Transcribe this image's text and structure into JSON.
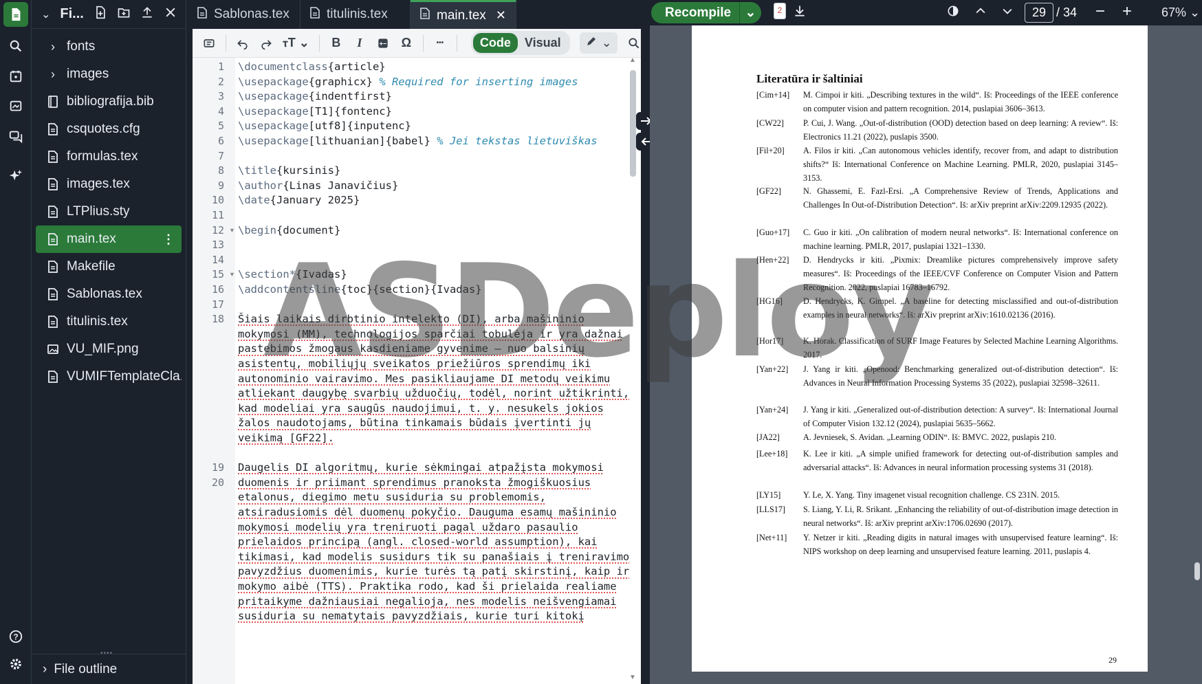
{
  "file_tree": {
    "title": "Fi...",
    "items": [
      {
        "name": "fonts",
        "type": "folder"
      },
      {
        "name": "images",
        "type": "folder"
      },
      {
        "name": "bibliografija.bib",
        "type": "bib"
      },
      {
        "name": "csquotes.cfg",
        "type": "file"
      },
      {
        "name": "formulas.tex",
        "type": "file"
      },
      {
        "name": "images.tex",
        "type": "file"
      },
      {
        "name": "LTPlius.sty",
        "type": "file"
      },
      {
        "name": "main.tex",
        "type": "file",
        "selected": true
      },
      {
        "name": "Makefile",
        "type": "file"
      },
      {
        "name": "Sablonas.tex",
        "type": "file"
      },
      {
        "name": "titulinis.tex",
        "type": "file"
      },
      {
        "name": "VU_MIF.png",
        "type": "image"
      },
      {
        "name": "VUMIFTemplateCla...",
        "type": "file"
      }
    ],
    "outline_label": "File outline"
  },
  "tabs": [
    {
      "label": "Sablonas.tex"
    },
    {
      "label": "titulinis.tex"
    },
    {
      "label": "main.tex",
      "active": true
    }
  ],
  "toolbar": {
    "text_size_label": "ⲧT",
    "bold_label": "B",
    "italic_label": "I",
    "omega_label": "Ω",
    "more_label": "•••",
    "code_label": "Code",
    "visual_label": "Visual"
  },
  "editor": {
    "line_numbers": [
      "1",
      "2",
      "3",
      "4",
      "5",
      "6",
      "7",
      "8",
      "9",
      "10",
      "11",
      "12",
      "13",
      "14",
      "15",
      "16",
      "17",
      "18",
      "",
      "",
      "",
      "",
      "",
      "",
      "",
      "",
      "",
      "19",
      "20"
    ],
    "lines": [
      "\\documentclass{article}",
      "\\usepackage{graphicx} % Required for inserting images",
      "\\usepackage{indentfirst}",
      "\\usepackage[T1]{fontenc}",
      "\\usepackage[utf8]{inputenc}",
      "\\usepackage[lithuanian]{babel} % Jei tekstas lietuviškas",
      "",
      "\\title{kursinis}",
      "\\author{Linas Janavičius}",
      "\\date{January 2025}",
      "",
      "\\begin{document}",
      "",
      "",
      "\\section*{Ivadas}",
      "\\addcontentsline{toc}{section}{Ivadas}",
      "",
      "Šiais laikais dirbtinio intelekto (DI), arba mašininio",
      "mokymosi (MM), technologijos sparčiai tobulėja ir yra dažnai",
      "pastebimos žmogaus kasdieniame gyvenime – nuo balsinių",
      "asistentų, mobiliųjų sveikatos priežiūros sprendimų iki",
      "autonominio vairavimo. Mes pasikliaujame DI metodų veikimu",
      "atliekant daugybę svarbių užduočių, todėl, norint užtikrinti,",
      "kad modeliai yra saugūs naudojimui, t. y. nesukels jokios",
      "žalos naudotojams, būtina tinkamais būdais įvertinti jų",
      "veikimą [GF22].",
      "",
      "Daugelis DI algoritmų, kurie sėkmingai atpažįsta mokymosi",
      "duomenis ir priimant sprendimus pranoksta žmogiškuosius",
      "etalonus, diegimo metu susiduria su problemomis,",
      "atsiradusiomis dėl duomenų pokyčio. Dauguma esamų mašininio",
      "mokymosi modelių yra treniruoti pagal uždaro pasaulio",
      "prielaidos principą (angl. closed-world assumption), kai",
      "tikimasi, kad modelis susidurs tik su panašiais į treniravimo",
      "pavyzdžius duomenimis, kurie turės tą patį skirstinį, kaip ir",
      "mokymo aibė (TTS). Praktika rodo, kad ši prielaida realiame",
      "pritaikyme dažniausiai negalioja, nes modelis neišvengiamai",
      "susiduria su nematytais pavyzdžiais, kurie turi kitokį"
    ]
  },
  "pdf": {
    "recompile_label": "Recompile",
    "log_badge": "2",
    "page_current": "29",
    "page_total": "/ 34",
    "zoom": "67%",
    "page_number": "29",
    "section_title": "Literatūra ir šaltiniai",
    "references": [
      {
        "key": "[Cim+14]",
        "text": "M. Cimpoi ir kiti. „Describing textures in the wild“. Iš: Proceedings of the IEEE conference on computer vision and pattern recognition. 2014, puslapiai 3606–3613."
      },
      {
        "key": "[CW22]",
        "text": "P. Cui, J. Wang. „Out-of-distribution (OOD) detection based on deep learning: A review“. Iš: Electronics 11.21 (2022), puslapis 3500."
      },
      {
        "key": "[Fil+20]",
        "text": "A. Filos ir kiti. „Can autonomous vehicles identify, recover from, and adapt to distribution shifts?“ Iš: International Conference on Machine Learning. PMLR, 2020, puslapiai 3145–3153."
      },
      {
        "key": "[GF22]",
        "text": "N. Ghassemi, E. Fazl-Ersi. „A Comprehensive Review of Trends, Applications and Challenges In Out-of-Distribution Detection“. Iš: arXiv preprint arXiv:2209.12935 (2022)."
      },
      {
        "key": "[Guo+17]",
        "text": "C. Guo ir kiti. „On calibration of modern neural networks“. Iš: International conference on machine learning. PMLR, 2017, puslapiai 1321–1330."
      },
      {
        "key": "[Hen+22]",
        "text": "D. Hendrycks ir kiti. „Pixmix: Dreamlike pictures comprehensively improve safety measures“. Iš: Proceedings of the IEEE/CVF Conference on Computer Vision and Pattern Recognition. 2022, puslapiai 16783–16792."
      },
      {
        "key": "[HG16]",
        "text": "D. Hendrycks, K. Gimpel. „A baseline for detecting misclassified and out-of-distribution examples in neural networks“. Iš: arXiv preprint arXiv:1610.02136 (2016)."
      },
      {
        "key": "[Hor17]",
        "text": "K. Horak. Classification of SURF Image Features by Selected Machine Learning Algorithms. 2017."
      },
      {
        "key": "[Yan+22]",
        "text": "J. Yang ir kiti. „Openood: Benchmarking generalized out-of-distribution detection“. Iš: Advances in Neural Information Processing Systems 35 (2022), puslapiai 32598–32611."
      },
      {
        "key": "[Yan+24]",
        "text": "J. Yang ir kiti. „Generalized out-of-distribution detection: A survey“. Iš: International Journal of Computer Vision 132.12 (2024), puslapiai 5635–5662."
      },
      {
        "key": "[JA22]",
        "text": "A. Jevniesek, S. Avidan. „Learning ODIN“. Iš: BMVC. 2022, puslapis 210."
      },
      {
        "key": "[Lee+18]",
        "text": "K. Lee ir kiti. „A simple unified framework for detecting out-of-distribution samples and adversarial attacks“. Iš: Advances in neural information processing systems 31 (2018)."
      },
      {
        "key": "[LY15]",
        "text": "Y. Le, X. Yang. Tiny imagenet visual recognition challenge. CS 231N. 2015."
      },
      {
        "key": "[LLS17]",
        "text": "S. Liang, Y. Li, R. Srikant. „Enhancing the reliability of out-of-distribution image detection in neural networks“. Iš: arXiv preprint arXiv:1706.02690 (2017)."
      },
      {
        "key": "[Net+11]",
        "text": "Y. Netzer ir kiti. „Reading digits in natural images with unsupervised feature learning“. Iš: NIPS workshop on deep learning and unsupervised feature learning. 2011, puslapis 4."
      }
    ]
  },
  "watermark": "ASDeploy",
  "colors": {
    "accent_green": "#2b7a3a",
    "dark_bg": "#1b222c",
    "pdf_bg": "#525a65"
  }
}
